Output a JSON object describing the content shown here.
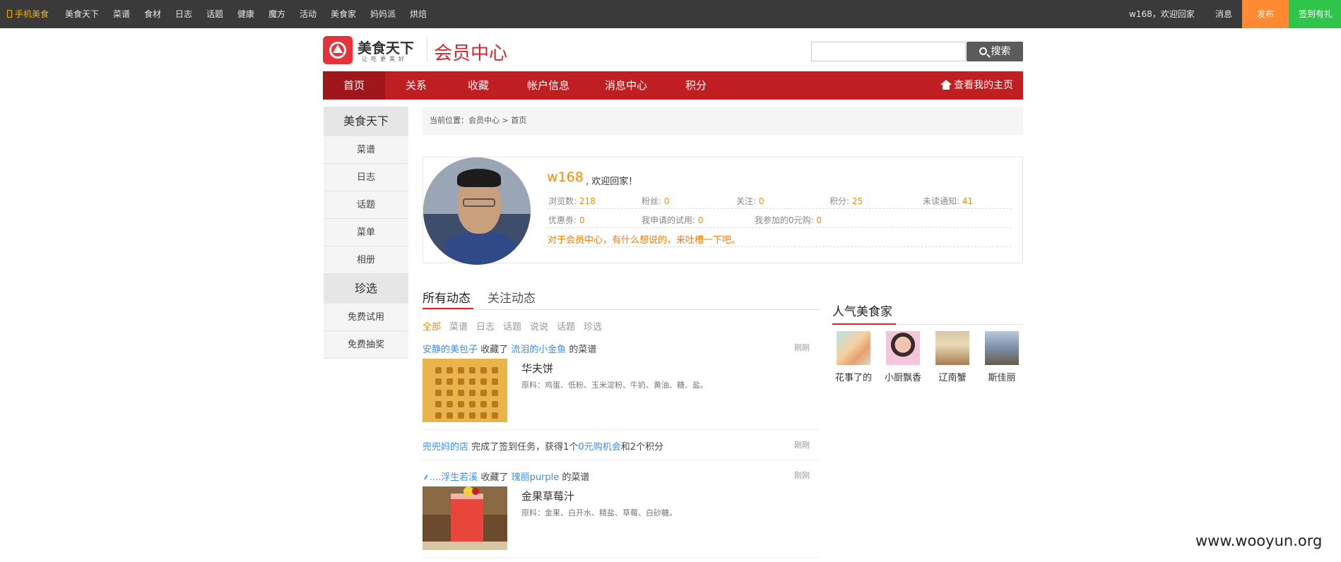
{
  "topbar": {
    "mobile": "手机美食",
    "links": [
      "美食天下",
      "菜谱",
      "食材",
      "日志",
      "话题",
      "健康",
      "魔方",
      "活动",
      "美食家",
      "妈妈派",
      "烘焙"
    ],
    "greeting": "w168，欢迎回家",
    "messages": "消息",
    "publish": "发布",
    "signin": "签到有礼",
    "colors": {
      "bar": "#3a3a3a",
      "publish": "#ff8a33",
      "signin": "#2ec54a"
    }
  },
  "header": {
    "logo_title": "美食天下",
    "logo_sub": "让吃更美好",
    "member_title": "会员中心",
    "search_placeholder": "",
    "search_button": "搜索"
  },
  "nav": {
    "tabs": [
      "首页",
      "关系",
      "收藏",
      "帐户信息",
      "消息中心",
      "积分"
    ],
    "active": "首页",
    "home_link": "查看我的主页",
    "color": "#bf1e22"
  },
  "sidebar": {
    "sections": [
      {
        "title": "美食天下",
        "items": [
          "菜谱",
          "日志",
          "话题",
          "菜单",
          "相册"
        ]
      },
      {
        "title": "珍选",
        "items": [
          "免费试用",
          "免费抽奖"
        ]
      }
    ]
  },
  "breadcrumb": "当前位置：会员中心 > 首页",
  "profile": {
    "username": "w168",
    "welcome": ", 欢迎回家！",
    "stats_row1": [
      {
        "label": "浏览数: ",
        "value": "218"
      },
      {
        "label": "粉丝: ",
        "value": "0"
      },
      {
        "label": "关注: ",
        "value": "0"
      },
      {
        "label": "积分: ",
        "value": "25"
      },
      {
        "label": "未读通知: ",
        "value": "41"
      }
    ],
    "stats_row2": [
      {
        "label": "优惠劵: ",
        "value": "0"
      },
      {
        "label": "我申请的试用: ",
        "value": "0"
      },
      {
        "label": "我参加的0元购: ",
        "value": "0"
      }
    ],
    "feedback": "对于会员中心，有什么想说的，来吐槽一下吧。"
  },
  "feed": {
    "tabs": [
      "所有动态",
      "关注动态"
    ],
    "filters": [
      "全部",
      "菜谱",
      "日志",
      "话题",
      "说说",
      "话题",
      "珍选"
    ],
    "items": [
      {
        "user": "安静的美包子",
        "action": " 收藏了 ",
        "target": "流泪的小金鱼",
        "suffix": " 的菜谱",
        "time": "刚刚",
        "dish": "华夫饼",
        "ingredients": "原料：鸡蛋、低粉、玉米淀粉、牛奶、黄油、糖、盐。"
      },
      {
        "user": "兜兜妈的店",
        "action": " 完成了签到任务，获得1个",
        "target": "0元购机会",
        "suffix": "和2个积分",
        "time": "刚刚"
      },
      {
        "user": "....浮生若溪",
        "action": " 收藏了 ",
        "target": "瑰丽purple",
        "suffix": " 的菜谱",
        "time": "刚刚",
        "dish": "金果草莓汁",
        "ingredients": "原料：金果、白开水、精盐、草莓、白砂糖。"
      }
    ]
  },
  "popular": {
    "title": "人气美食家",
    "users": [
      "花事了的",
      "小厨飘香",
      "辽南蟹",
      "斯佳丽"
    ]
  },
  "watermark": "www.wooyun.org"
}
